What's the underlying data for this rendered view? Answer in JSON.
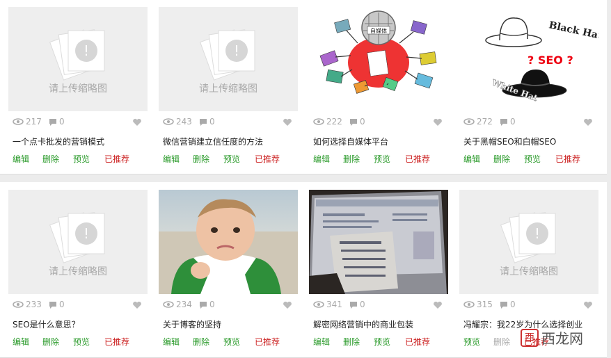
{
  "placeholder_text": "请上传缩略图",
  "actions": {
    "edit": "编辑",
    "delete": "删除",
    "preview": "预览",
    "recommended": "已推荐"
  },
  "cards": [
    {
      "views": "217",
      "comments": "0",
      "title": "一个点卡批发的营销模式",
      "thumb": "placeholder"
    },
    {
      "views": "243",
      "comments": "0",
      "title": "微信营销建立信任度的方法",
      "thumb": "placeholder"
    },
    {
      "views": "222",
      "comments": "0",
      "title": "如何选择自媒体平台",
      "thumb": "cartoon",
      "thumb_text": "自媒体"
    },
    {
      "views": "272",
      "comments": "0",
      "title": "关于黑帽SEO和白帽SEO",
      "thumb": "hats",
      "thumb_text": {
        "black": "Black Hat",
        "seo": "? SEO ?",
        "white": "White Hat"
      }
    },
    {
      "views": "233",
      "comments": "0",
      "title": "SEO是什么意思？",
      "thumb": "placeholder"
    },
    {
      "views": "234",
      "comments": "0",
      "title": "关于博客的坚持",
      "thumb": "baby"
    },
    {
      "views": "341",
      "comments": "0",
      "title": "解密网络营销中的商业包装",
      "thumb": "screen"
    },
    {
      "views": "315",
      "comments": "0",
      "title": "冯耀宗：我22岁为什么选择创业",
      "thumb": "placeholder"
    }
  ],
  "watermark": {
    "text": "西龙网",
    "box": "西"
  },
  "colors": {
    "green": "#2a9a2a",
    "red": "#cc2222",
    "placeholder_bg": "#eeeeee"
  }
}
